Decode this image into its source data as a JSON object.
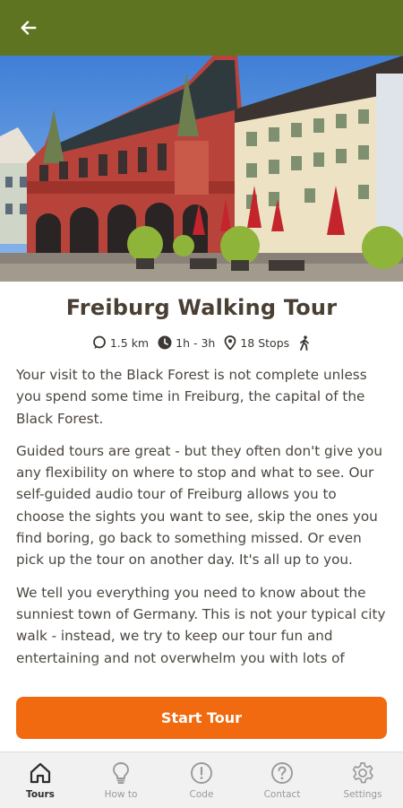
{
  "header": {
    "back_icon": "arrow-left-icon",
    "bg_color": "#5e7421"
  },
  "hero": {
    "image": "photo-freiburg-historic-merchants-hall-red-building-and-square"
  },
  "tour": {
    "title": "Freiburg Walking Tour",
    "distance": "1.5 km",
    "duration": "1h - 3h",
    "stops": "18 Stops",
    "mode_icon": "walking-person-icon"
  },
  "description": {
    "paragraphs": [
      "Your visit to the Black Forest is not complete unless you spend some time in Freiburg, the capital of the Black Forest.",
      "Guided tours are great - but they often don't give you any flexibility on where to stop and what to see. Our self-guided audio tour of Freiburg allows you to choose the sights you want to see, skip the ones you find boring, go back to something missed. Or even pick up the tour on another day. It's all up to you.",
      "We tell you everything you need to know about the sunniest town of Germany. This is not your typical city walk - instead, we try to keep our tour fun and entertaining and not overwhelm you with lots of"
    ]
  },
  "actions": {
    "start_label": "Start Tour",
    "accent_color": "#f26a0f"
  },
  "tabbar": {
    "items": [
      {
        "label": "Tours",
        "icon": "home-icon",
        "active": true
      },
      {
        "label": "How to",
        "icon": "lightbulb-icon",
        "active": false
      },
      {
        "label": "Code",
        "icon": "exclamation-circle-icon",
        "active": false
      },
      {
        "label": "Contact",
        "icon": "question-circle-icon",
        "active": false
      },
      {
        "label": "Settings",
        "icon": "gear-icon",
        "active": false
      }
    ]
  }
}
